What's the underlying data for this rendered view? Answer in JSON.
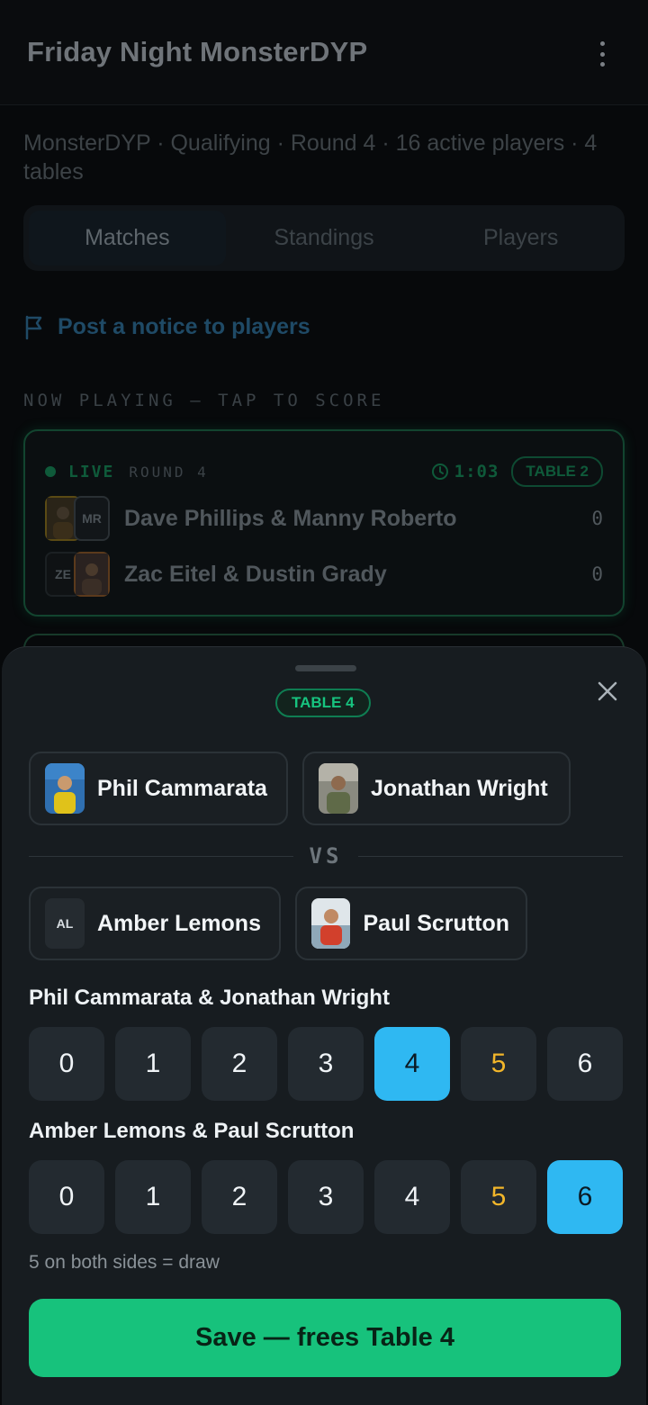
{
  "header": {
    "title": "Friday Night MonsterDYP"
  },
  "subtitle": "MonsterDYP · Qualifying · Round 4 · 16 active players · 4 tables",
  "tabs": [
    {
      "label": "Matches",
      "active": true
    },
    {
      "label": "Standings",
      "active": false
    },
    {
      "label": "Players",
      "active": false
    }
  ],
  "notice_link": "Post a notice to players",
  "section_label": "NOW PLAYING — TAP TO SCORE",
  "live_match": {
    "status": "LIVE",
    "round": "ROUND 4",
    "timer": "1:03",
    "table": "TABLE 2",
    "team1": {
      "name": "Dave Phillips & Manny Roberto",
      "score": "0",
      "initials": [
        "",
        "MR"
      ]
    },
    "team2": {
      "name": "Zac Eitel & Dustin Grady",
      "score": "0",
      "initials": [
        "ZE",
        ""
      ]
    }
  },
  "sheet": {
    "table_pill": "TABLE 4",
    "vs": "VS",
    "players": [
      {
        "name": "Phil Cammarata"
      },
      {
        "name": "Jonathan Wright"
      },
      {
        "name": "Amber Lemons",
        "initials": "AL"
      },
      {
        "name": "Paul Scrutton"
      }
    ],
    "team1_label": "Phil Cammarata & Jonathan Wright",
    "team2_label": "Amber Lemons & Paul Scrutton",
    "score_options": [
      "0",
      "1",
      "2",
      "3",
      "4",
      "5",
      "6"
    ],
    "team1_selected": "4",
    "team2_selected": "6",
    "draw_value": "5",
    "hint": "5 on both sides = draw",
    "save_label": "Save — frees Table 4"
  },
  "colors": {
    "accent_green": "#17c27c",
    "selected_blue": "#2fb8f2",
    "draw_yellow": "#f2b62a"
  }
}
